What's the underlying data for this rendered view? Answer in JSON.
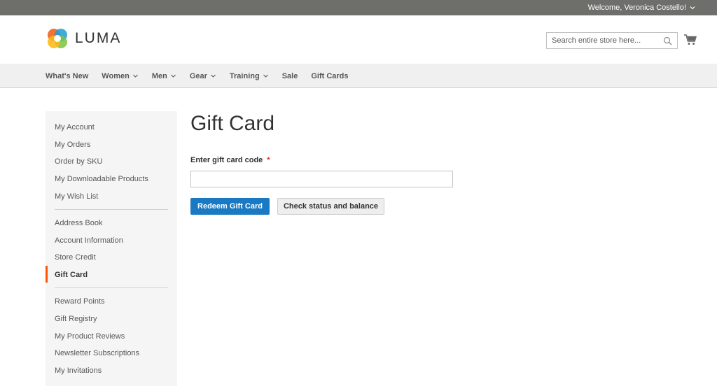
{
  "topbar": {
    "welcome": "Welcome, Veronica Costello!",
    "icon": "chevron-down-icon"
  },
  "header": {
    "brand": "LUMA",
    "search": {
      "placeholder": "Search entire store here...",
      "value": "",
      "icon": "search-icon"
    },
    "cart_icon": "cart-icon"
  },
  "nav": {
    "items": [
      {
        "label": "What's New",
        "has_dropdown": false
      },
      {
        "label": "Women",
        "has_dropdown": true
      },
      {
        "label": "Men",
        "has_dropdown": true
      },
      {
        "label": "Gear",
        "has_dropdown": true
      },
      {
        "label": "Training",
        "has_dropdown": true
      },
      {
        "label": "Sale",
        "has_dropdown": false
      },
      {
        "label": "Gift Cards",
        "has_dropdown": false
      }
    ]
  },
  "sidebar": {
    "items": [
      "My Account",
      "My Orders",
      "Order by SKU",
      "My Downloadable Products",
      "My Wish List",
      "Address Book",
      "Account Information",
      "Store Credit",
      "Gift Card",
      "Reward Points",
      "Gift Registry",
      "My Product Reviews",
      "Newsletter Subscriptions",
      "My Invitations"
    ],
    "active": "Gift Card"
  },
  "main": {
    "title": "Gift Card",
    "field_label": "Enter gift card code",
    "required_mark": "*",
    "code_value": "",
    "redeem_label": "Redeem Gift Card",
    "check_label": "Check status and balance"
  },
  "colors": {
    "accent": "#1979c3",
    "active_marker": "#ff5501",
    "required": "#e02b27",
    "topbar": "#6e6e6b"
  }
}
